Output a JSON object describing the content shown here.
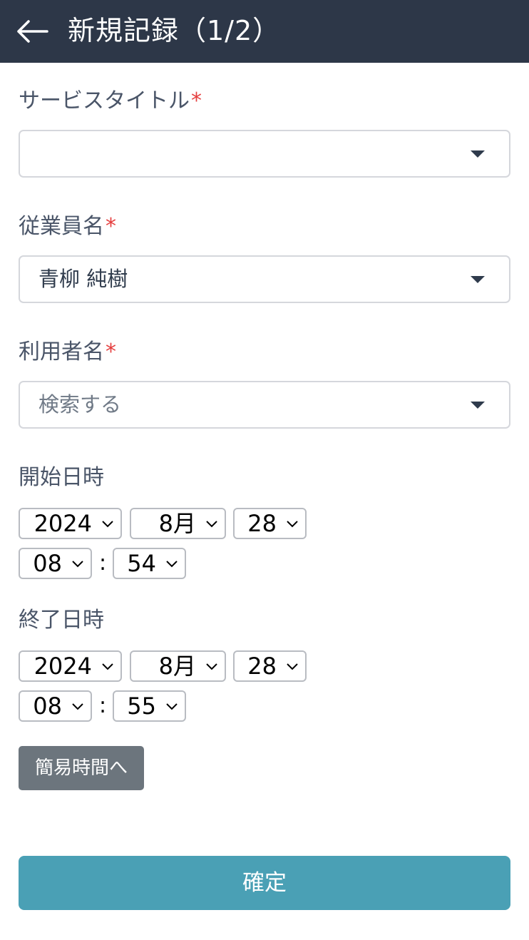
{
  "header": {
    "title": "新規記録（1/2）",
    "back_icon": "arrow-left-icon"
  },
  "form": {
    "service_title": {
      "label": "サービスタイトル",
      "required": "*",
      "value": ""
    },
    "employee": {
      "label": "従業員名",
      "required": "*",
      "value": "青柳 純樹"
    },
    "user": {
      "label": "利用者名",
      "required": "*",
      "placeholder": "検索する"
    },
    "start": {
      "label": "開始日時",
      "year": "2024",
      "month": "8月",
      "day": "28",
      "hour": "08",
      "minute": "54",
      "colon": ":"
    },
    "end": {
      "label": "終了日時",
      "year": "2024",
      "month": "8月",
      "day": "28",
      "hour": "08",
      "minute": "55",
      "colon": ":"
    }
  },
  "buttons": {
    "simple_time": "簡易時間へ",
    "confirm": "確定"
  },
  "colors": {
    "header_bg": "#2d3748",
    "required": "#e53e3e",
    "confirm_bg": "#4aa0b5",
    "secondary_bg": "#6c757d"
  }
}
